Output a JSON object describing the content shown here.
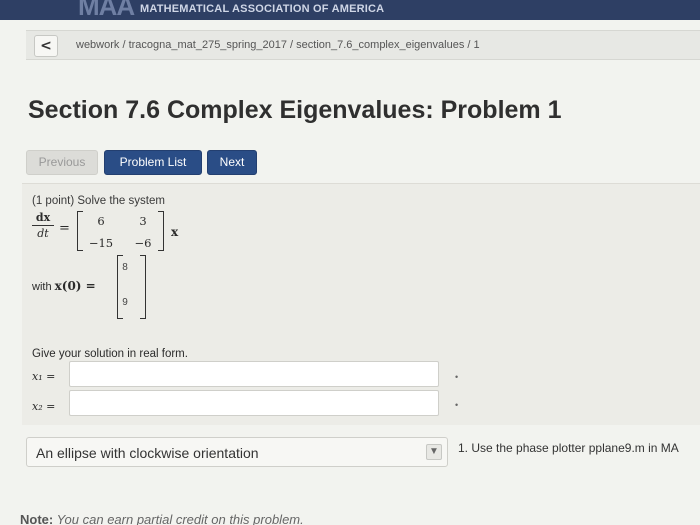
{
  "header": {
    "logo_text": "MAA",
    "org_name": "MATHEMATICAL ASSOCIATION OF AMERICA"
  },
  "breadcrumb": {
    "back_label": "<",
    "items": [
      "webwork",
      "tracogna_mat_275_spring_2017",
      "section_7.6_complex_eigenvalues",
      "1"
    ],
    "separator": " / "
  },
  "page": {
    "title": "Section 7.6 Complex Eigenvalues: Problem 1"
  },
  "nav": {
    "previous": "Previous",
    "problem_list": "Problem List",
    "next": "Next"
  },
  "problem": {
    "intro": "(1 point) Solve the system",
    "deriv_num": "dx",
    "deriv_den": "dt",
    "equals": "=",
    "matrix": [
      [
        "6",
        "3"
      ],
      [
        "−15",
        "−6"
      ]
    ],
    "vector_var": "x",
    "with_label": "with",
    "initial_lhs": "x(0) =",
    "initial_vector": [
      "8",
      "9"
    ],
    "solution_prompt": "Give your solution in real form.",
    "inputs": [
      {
        "label": "x₁ =",
        "value": ""
      },
      {
        "label": "x₂ =",
        "value": ""
      }
    ]
  },
  "dropdown": {
    "selected": "An ellipse with clockwise orientation"
  },
  "side_note": "1. Use the phase plotter pplane9.m in MA",
  "footer_note": {
    "bold": "Note:",
    "text": " You can earn partial credit on this problem."
  },
  "colors": {
    "topbar": "#2e3f64",
    "primary_button": "#2a4d86",
    "background": "#f2f3ef"
  }
}
